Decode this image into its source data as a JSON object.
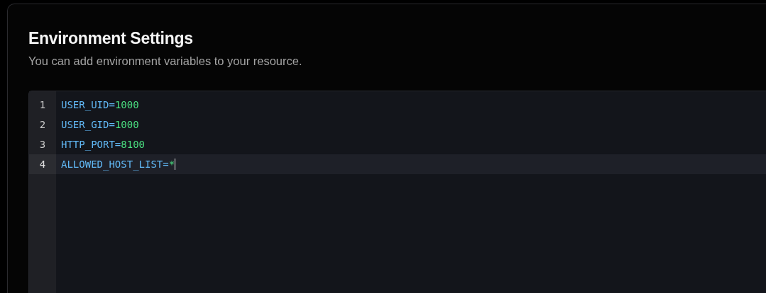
{
  "title": "Environment Settings",
  "subtitle": "You can add environment variables to your resource.",
  "editor": {
    "lines": [
      {
        "number": "1",
        "key": "USER_UID",
        "operator": "=",
        "value": "1000",
        "selected": false
      },
      {
        "number": "2",
        "key": "USER_GID",
        "operator": "=",
        "value": "1000",
        "selected": false
      },
      {
        "number": "3",
        "key": "HTTP_PORT",
        "operator": "=",
        "value": "8100",
        "selected": false
      },
      {
        "number": "4",
        "key": "ALLOWED_HOST_LIST",
        "operator": "=",
        "value": "*",
        "selected": true
      }
    ]
  }
}
